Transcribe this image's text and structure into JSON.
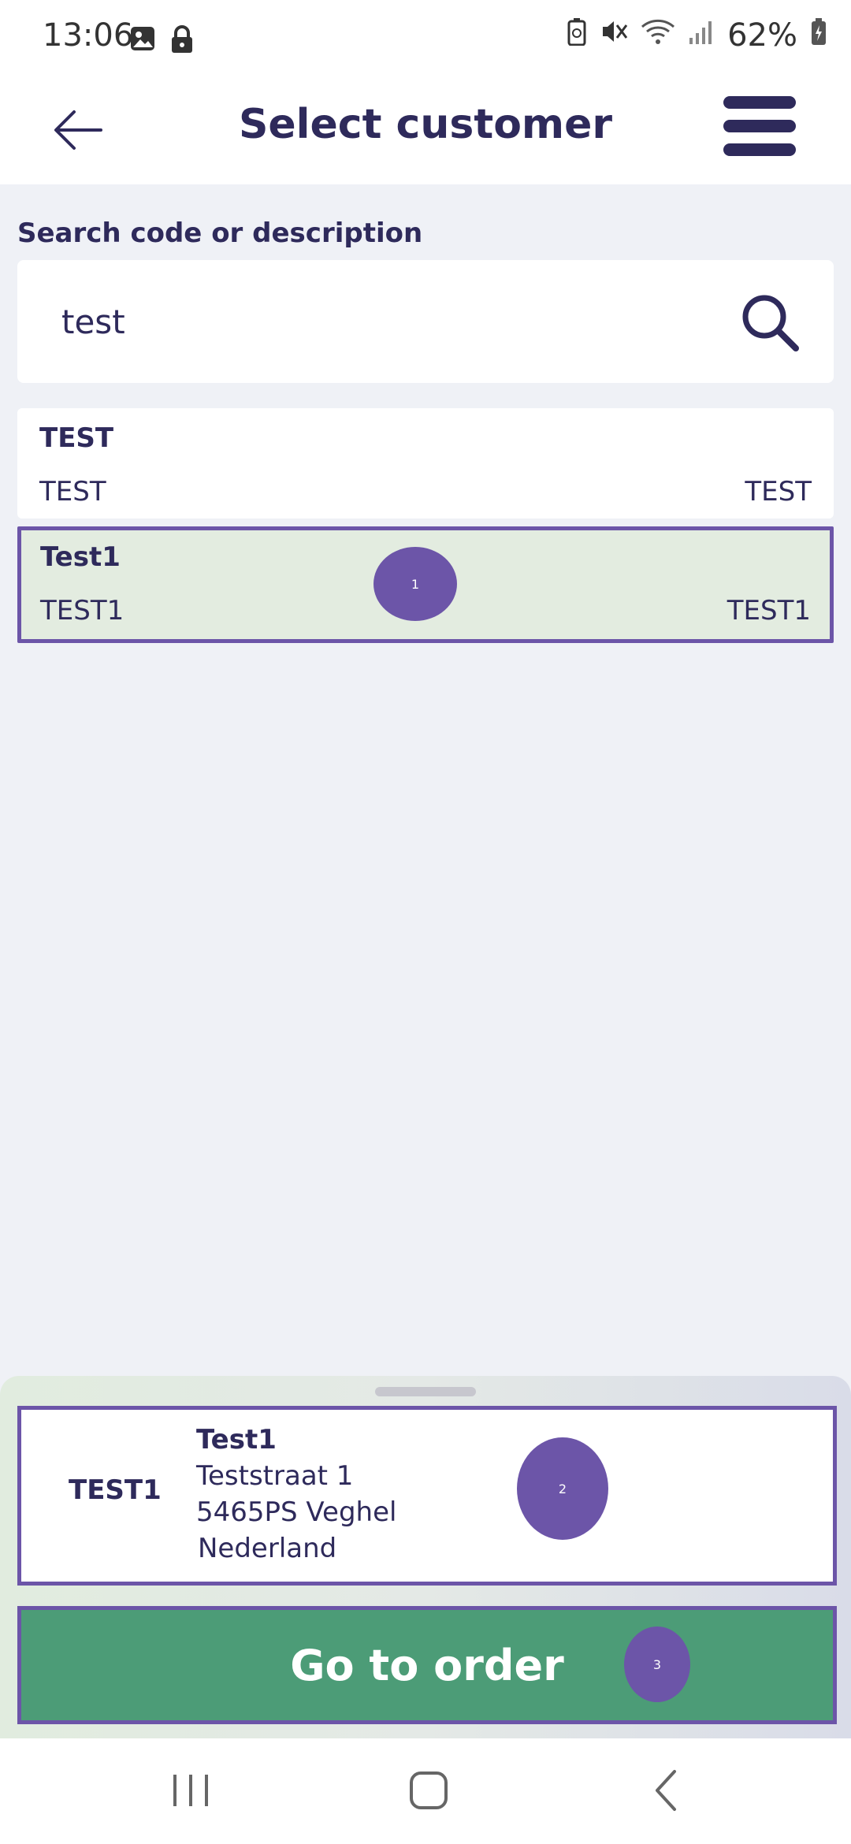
{
  "status_bar": {
    "time": "13:06",
    "battery": "62%"
  },
  "header": {
    "title": "Select customer"
  },
  "search": {
    "label": "Search code or description",
    "value": "test"
  },
  "results": [
    {
      "title": "TEST",
      "code": "TEST",
      "right": "TEST"
    },
    {
      "title": "Test1",
      "code": "TEST1",
      "right": "TEST1"
    }
  ],
  "markers": [
    "1",
    "2",
    "3"
  ],
  "selected_customer": {
    "code": "TEST1",
    "name": "Test1",
    "street": "Teststraat 1",
    "city": "5465PS Veghel",
    "country": "Nederland"
  },
  "actions": {
    "go_to_order": "Go to order"
  },
  "colors": {
    "accent": "#6c55a8",
    "primary_text": "#2e2a5b",
    "button_green": "#4c9c77",
    "selected_bg": "#e3ece0"
  }
}
